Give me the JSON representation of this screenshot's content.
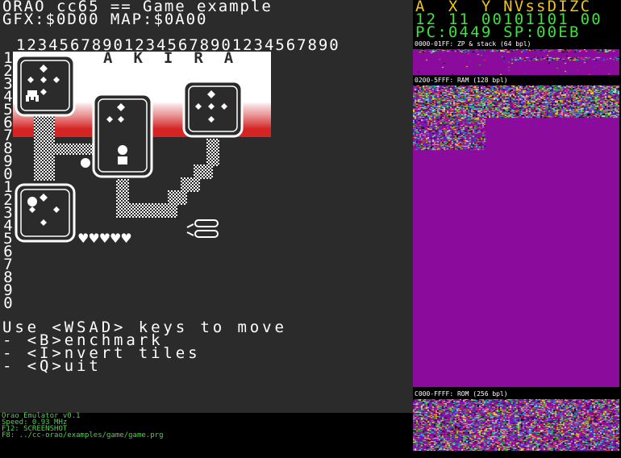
{
  "screen": {
    "title_line": "ORAO cc65 == Game example",
    "gfx_line": "GFX:$0D00 MAP:$0A00",
    "column_ruler": "123456789012345678901234567890",
    "row_numbers": [
      "1",
      "2",
      "3",
      "4",
      "5",
      "6",
      "7",
      "8",
      "9",
      "0",
      "1",
      "2",
      "3",
      "4",
      "5",
      "6",
      "7",
      "8",
      "9",
      "0"
    ],
    "game_banner": "AKIRA",
    "hearts": "♥♥♥♥♥",
    "instructions": [
      "Use <WSAD> keys to move",
      "- <B>enchmark",
      "- <I>nvert tiles",
      "- <Q>uit"
    ]
  },
  "status": {
    "version": "Orao Emulator v0.1",
    "speed": "Speed: 0.93 MHz",
    "f12": "F12: SCREENSHOT",
    "f8": "F8: ../cc-orao/examples/game/game.prg"
  },
  "registers": {
    "header": "A  X  Y NVssDIZC",
    "values": "12 11 00101101 00",
    "pc_sp": "PC:0449 SP:00EB"
  },
  "memory": {
    "zp_label": "0000-01FF: ZP & stack (64 bpl)",
    "ram_label": "0200-5FFF: RAM (128 bpl)",
    "rom_label": "C000-FFFF: ROM (256 bpl)"
  },
  "colors": {
    "register_header": "#f0c419",
    "register_values": "#3ce13c",
    "memory_bg": "#8b0c9c",
    "screen_bg": "#2b2b2b",
    "status_text": "#4cd24c"
  }
}
